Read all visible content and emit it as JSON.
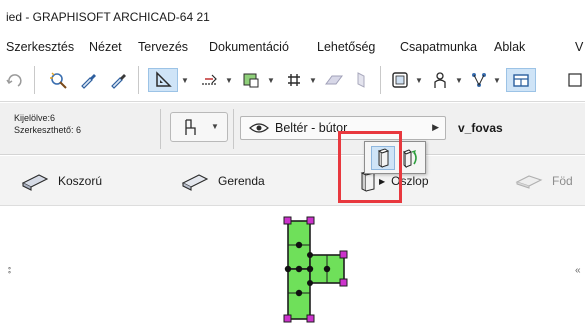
{
  "window": {
    "title": "ied - GRAPHISOFT ARCHICAD-64 21"
  },
  "menu": [
    "Szerkesztés",
    "Nézet",
    "Tervezés",
    "Dokumentáció",
    "Lehetőség",
    "Csapatmunka",
    "Ablak",
    "V"
  ],
  "toolbar": {
    "icons": [
      "rotate-icon",
      "magic-wand-icon",
      "eyedropper-icon",
      "eyedropper-icon",
      "triangle-tool-icon",
      "dimension-icon",
      "marquee-icon",
      "grid-snap-icon",
      "plane-icon",
      "layer-shape-icon",
      "view-frame-icon",
      "person-icon",
      "network-icon",
      "window-icon"
    ]
  },
  "info_box": {
    "selected": "Kijelölve:6",
    "editable": "Szerkeszthető: 6",
    "layer_label": "Beltér - bútor",
    "layer_name": "v_fovas"
  },
  "tools": [
    {
      "label": "Koszorú",
      "icon": "beam-icon"
    },
    {
      "label": "Gerenda",
      "icon": "beam-icon"
    },
    {
      "label": "Oszlop",
      "icon": "column-icon"
    },
    {
      "label": "Föd",
      "icon": "slab-icon"
    }
  ],
  "flyout": {
    "options": [
      {
        "name": "straight-column",
        "selected": true
      },
      {
        "name": "slanted-column",
        "selected": false
      }
    ]
  },
  "colors": {
    "highlight": "#cfe4f7",
    "red_outline": "#e8383e",
    "column_fill": "#6fe05a",
    "node_magenta": "#cc33cc"
  }
}
